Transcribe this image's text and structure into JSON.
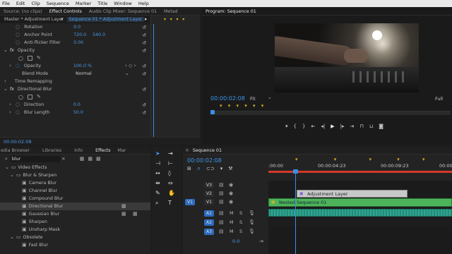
{
  "menu": [
    "File",
    "Edit",
    "Clip",
    "Sequence",
    "Marker",
    "Title",
    "Window",
    "Help"
  ],
  "top_left_tabs": {
    "source": "Source: (no clips)",
    "effect_controls": "Effect Controls",
    "audio_mixer": "Audio Clip Mixer: Sequence 01",
    "metadata": "Metad"
  },
  "ec_header": {
    "master": "Master * Adjustment Layer",
    "sequence": "Sequence 01 * Adjustment Layer"
  },
  "ec_rows": {
    "rotation_label": "Rotation",
    "rotation_val": "0.0",
    "anchor_label": "Anchor Point",
    "anchor_x": "720.0",
    "anchor_y": "540.0",
    "antiflicker_label": "Anti-flicker Filter",
    "antiflicker_val": "0.00",
    "opacity_section": "Opacity",
    "opacity_label": "Opacity",
    "opacity_val": "100.0 %",
    "blend_label": "Blend Mode",
    "blend_val": "Normal",
    "time_remap": "Time Remapping",
    "dir_blur": "Directional Blur",
    "direction_label": "Direction",
    "direction_val": "0.0",
    "blur_length_label": "Blur Length",
    "blur_length_val": "50.0",
    "fx": "fx"
  },
  "ec_timecode": "00:00:02:08",
  "program": {
    "title": "Program: Sequence 01",
    "timecode": "00:00:02:08",
    "fit": "Fit",
    "full": "Full"
  },
  "effects_tabs": {
    "media": "edia Browser",
    "libraries": "Libraries",
    "info": "Info",
    "effects": "Effects",
    "markers": "Mar"
  },
  "search": {
    "value": "blur"
  },
  "effects_tree": {
    "video_effects": "Video Effects",
    "blur_sharpen": "Blur & Sharpen",
    "items": [
      "Camera Blur",
      "Channel Blur",
      "Compound Blur",
      "Directional Blur",
      "Gaussian Blur",
      "Sharpen",
      "Unsharp Mask"
    ],
    "obsolete": "Obsolete",
    "fast_blur": "Fast Blur"
  },
  "timeline": {
    "tab": "Sequence 01",
    "timecode": "00:00:02:08",
    "ruler": [
      ":00:00",
      "00:00:04:23",
      "00:00:09:23",
      "00:00"
    ],
    "video_tracks": [
      "V3",
      "V2",
      "V1"
    ],
    "audio_tracks": [
      "A1",
      "A2",
      "A3"
    ],
    "src_v": "V1",
    "src_a": "A1",
    "clip_adjust": "Adjustment Layer",
    "clip_nested": "Nested Sequence 01",
    "master_val": "0.0",
    "m": "M",
    "s": "S"
  },
  "colors": {
    "accent": "#2d8ceb",
    "timecode": "#3f95ee",
    "adjust_clip": "#c8c8c8",
    "nested_clip": "#4db35a",
    "audio_clip": "#2a9a86",
    "playhead": "#3a8ee6"
  }
}
